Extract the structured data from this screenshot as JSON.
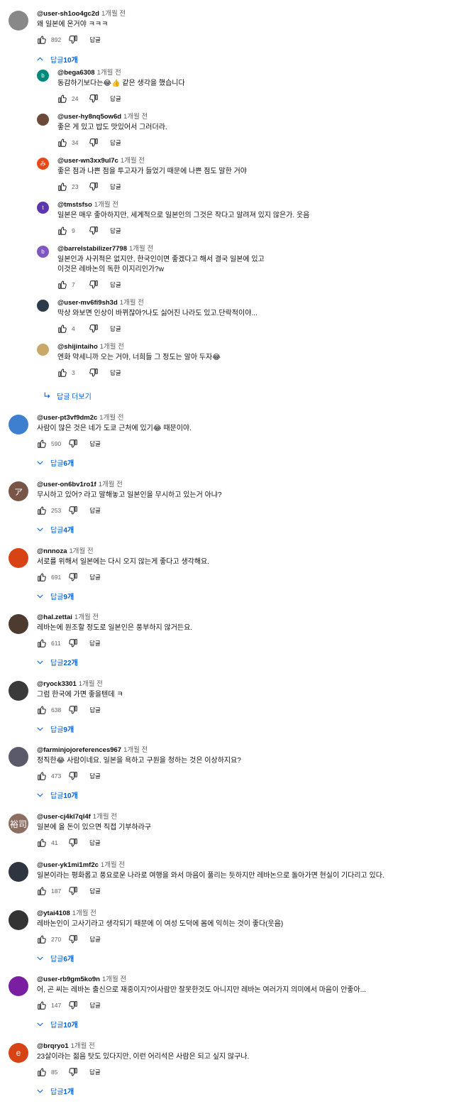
{
  "colors": {
    "link": "#065fd4",
    "meta": "#606060",
    "text": "#0f0f0f"
  },
  "labels": {
    "reply": "답글",
    "more_replies": "답글 더보기",
    "hide_replies_prefix": "답글"
  },
  "top_comment": {
    "author": "@user-sh1oo4gc2d",
    "time": "1개월 전",
    "text": "왜 일본에 온거야 ㅋㅋㅋ",
    "likes": "892",
    "replies_toggle": {
      "icon": "chevron-up-icon",
      "label": "답글",
      "count": "10개"
    }
  },
  "replies": [
    {
      "author": "@bega6308",
      "time": "1개월 전",
      "text": "동감하기보다는😂👍 같은 생각을 했습니다",
      "likes": "24",
      "avatar_letter": "b",
      "avatar_color": "#00897b"
    },
    {
      "author": "@user-hy8nq5ow6d",
      "time": "1개월 전",
      "text": "좋은 게 있고 밥도 맛있어서 그러더라.",
      "likes": "34",
      "avatar_letter": "",
      "avatar_color": "#6b4a3a"
    },
    {
      "author": "@user-wn3xx9ul7c",
      "time": "1개월 전",
      "text": "좋은 점과 나쁜 점을 투고자가 들었기 때문에 나쁜 점도 말한 거야",
      "likes": "23",
      "avatar_letter": "み",
      "avatar_color": "#e64a19"
    },
    {
      "author": "@tmstsfso",
      "time": "1개월 전",
      "text": "일본은 매우 좋아하지만, 세계적으로 일본인의 그것은 작다고 알려져 있지 않은가. 웃음",
      "likes": "9",
      "avatar_letter": "t",
      "avatar_color": "#5e35b1"
    },
    {
      "author": "@barrelstabilizer7798",
      "time": "1개월 전",
      "text": [
        "일본인과 사귀적은 없지만, 한국인이면 좋겠다고 해서 결국 일본에 있고",
        "이것은 레바논의 독한 이지리인가?w"
      ],
      "likes": "7",
      "avatar_letter": "b",
      "avatar_color": "#7e57c2"
    },
    {
      "author": "@user-mv6fi9sh3d",
      "time": "1개월 전",
      "text": "막상 와보면 인상이 바뀌잖아?나도 싫어진 나라도 있고.단락적이야...",
      "likes": "4",
      "avatar_letter": "",
      "avatar_color": "#2d3a4a"
    },
    {
      "author": "@shijintaiho",
      "time": "1개월 전",
      "text": "엔화 약세니까 오는 거야, 너희들 그 정도는 알아 두자😂",
      "likes": "3",
      "avatar_letter": "",
      "avatar_color": "#c9a86a"
    }
  ],
  "more_replies": {
    "icon": "reply-arrow-icon",
    "label": "답글 더보기"
  },
  "comments": [
    {
      "author": "@user-pt3vf9dm2c",
      "time": "1개월 전",
      "text": "사람이 많은 것은 네가 도쿄 근처에 있기😂 때문이야.",
      "likes": "590",
      "replies": "6개",
      "avatar_letter": "",
      "avatar_color": "#3f7fd0"
    },
    {
      "author": "@user-on6bv1ro1f",
      "time": "1개월 전",
      "text": "무시하고 있어? 라고 말해놓고 일본인을 무시하고 있는거 아냐?",
      "likes": "253",
      "replies": "4개",
      "avatar_letter": "ア",
      "avatar_color": "#795548"
    },
    {
      "author": "@nnnoza",
      "time": "1개월 전",
      "text": "서로를 위해서 일본에는 다시 오지 않는게 좋다고 생각해요.",
      "likes": "691",
      "replies": "9개",
      "avatar_letter": "",
      "avatar_color": "#d84315"
    },
    {
      "author": "@hal.zettai",
      "time": "1개월 전",
      "text": "레바논에 원조할 정도로 일본인은 풍부하지 않거든요.",
      "likes": "611",
      "replies": "22개",
      "avatar_letter": "",
      "avatar_color": "#4e3b30"
    },
    {
      "author": "@ryock3301",
      "time": "1개월 전",
      "text": "그럼 한국에 가면 좋을텐데 ㅋ",
      "likes": "638",
      "replies": "9개",
      "avatar_letter": "",
      "avatar_color": "#3a3a3a"
    },
    {
      "author": "@farminjojoreferences967",
      "time": "1개월 전",
      "text": "정직한😂 사람이네요. 일본을 욕하고 구원을 청하는 것은 이상하지요?",
      "likes": "473",
      "replies": "10개",
      "avatar_letter": "",
      "avatar_color": "#5a5a6a"
    },
    {
      "author": "@user-cj4kl7ql4f",
      "time": "1개월 전",
      "text": "일본에 올 돈이 있으면 직접 기부하라구",
      "likes": "41",
      "replies": "",
      "avatar_letter": "裕司",
      "avatar_color": "#8d6e63"
    },
    {
      "author": "@user-yk1mi1mf2c",
      "time": "1개월 전",
      "text": "일본이라는 평화롭고 풍요로운 나라로 여행을 와서 마음이 풀리는 듯하지만 레바논으로 돌아가면 현실이 기다리고 있다.",
      "likes": "187",
      "replies": "",
      "avatar_letter": "",
      "avatar_color": "#2e3440"
    },
    {
      "author": "@ytai4108",
      "time": "1개월 전",
      "text": "레바논인이 고사기라고 생각되기 때문에 이 여성 도덕에 몸에 익히는 것이 좋다(웃음)",
      "likes": "270",
      "replies": "6개",
      "avatar_letter": "",
      "avatar_color": "#333333"
    },
    {
      "author": "@user-rb9gm5ko9n",
      "time": "1개월 전",
      "text": "어, 곤 씨는 레바논 출신으로 재중이지?이사람만 잘못한것도 아니지만 레바논 여러가지 의미에서 마음이 안좋아...",
      "likes": "147",
      "replies": "10개",
      "avatar_letter": "",
      "avatar_color": "#7b1fa2"
    },
    {
      "author": "@brqryo1",
      "time": "1개월 전",
      "text": "23살이라는 젊음 탓도 있다지만, 이런 어리석은 사람은 되고 싶지 않구나.",
      "likes": "85",
      "replies": "1개",
      "avatar_letter": "e",
      "avatar_color": "#d84315"
    }
  ]
}
